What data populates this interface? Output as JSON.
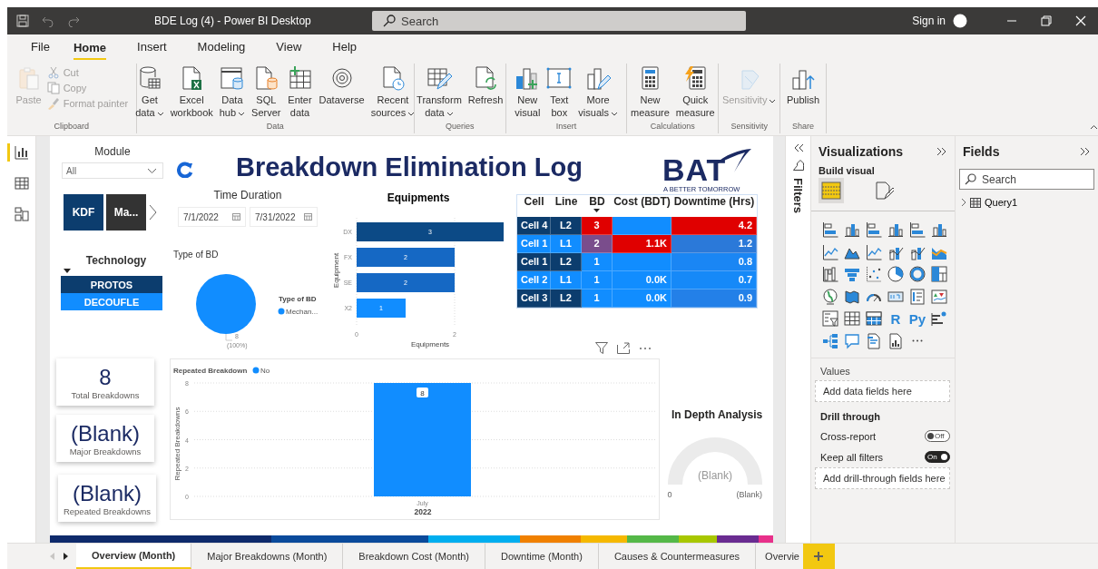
{
  "title_bar": {
    "title": "BDE Log (4) - Power BI Desktop",
    "search": {
      "placeholder": "Search"
    },
    "sign_in": "Sign in"
  },
  "menu_tabs": [
    {
      "label": "File",
      "selected": false
    },
    {
      "label": "Home",
      "selected": true
    },
    {
      "label": "Insert",
      "selected": false
    },
    {
      "label": "Modeling",
      "selected": false
    },
    {
      "label": "View",
      "selected": false
    },
    {
      "label": "Help",
      "selected": false
    }
  ],
  "ribbon": {
    "groups": [
      {
        "label": "Clipboard",
        "buttons": [
          {
            "kind": "large",
            "lines": [
              "Paste"
            ],
            "dropdown": false,
            "disabled": true
          },
          {
            "kind": "small",
            "lines": [
              "Cut"
            ],
            "dropdown": false,
            "disabled": true
          },
          {
            "kind": "small",
            "lines": [
              "Copy"
            ],
            "dropdown": false,
            "disabled": true
          },
          {
            "kind": "small",
            "lines": [
              "Format painter"
            ],
            "dropdown": false,
            "disabled": true
          }
        ]
      },
      {
        "label": "Data",
        "buttons": [
          {
            "kind": "large",
            "lines": [
              "Get",
              "data"
            ],
            "dropdown": true,
            "disabled": false
          },
          {
            "kind": "large",
            "lines": [
              "Excel",
              "workbook"
            ],
            "dropdown": false,
            "disabled": false
          },
          {
            "kind": "large",
            "lines": [
              "Data",
              "hub"
            ],
            "dropdown": true,
            "disabled": false
          },
          {
            "kind": "large",
            "lines": [
              "SQL",
              "Server"
            ],
            "dropdown": false,
            "disabled": false
          },
          {
            "kind": "large",
            "lines": [
              "Enter",
              "data"
            ],
            "dropdown": false,
            "disabled": false
          },
          {
            "kind": "large",
            "lines": [
              "Dataverse"
            ],
            "dropdown": false,
            "disabled": false
          },
          {
            "kind": "large",
            "lines": [
              "Recent",
              "sources"
            ],
            "dropdown": true,
            "disabled": false
          }
        ]
      },
      {
        "label": "Queries",
        "buttons": [
          {
            "kind": "large",
            "lines": [
              "Transform",
              "data"
            ],
            "dropdown": true,
            "disabled": false
          },
          {
            "kind": "large",
            "lines": [
              "Refresh"
            ],
            "dropdown": false,
            "disabled": false
          }
        ]
      },
      {
        "label": "Insert",
        "buttons": [
          {
            "kind": "large",
            "lines": [
              "New",
              "visual"
            ],
            "dropdown": false,
            "disabled": false
          },
          {
            "kind": "large",
            "lines": [
              "Text",
              "box"
            ],
            "dropdown": false,
            "disabled": false
          },
          {
            "kind": "large",
            "lines": [
              "More",
              "visuals"
            ],
            "dropdown": true,
            "disabled": false
          }
        ]
      },
      {
        "label": "Calculations",
        "buttons": [
          {
            "kind": "large",
            "lines": [
              "New",
              "measure"
            ],
            "dropdown": false,
            "disabled": false
          },
          {
            "kind": "large",
            "lines": [
              "Quick",
              "measure"
            ],
            "dropdown": false,
            "disabled": false
          }
        ]
      },
      {
        "label": "Sensitivity",
        "buttons": [
          {
            "kind": "large",
            "lines": [
              "Sensitivity"
            ],
            "dropdown": true,
            "disabled": true
          }
        ]
      },
      {
        "label": "Share",
        "buttons": [
          {
            "kind": "large",
            "lines": [
              "Publish"
            ],
            "dropdown": false,
            "disabled": false
          }
        ]
      }
    ]
  },
  "left_rail": {
    "views": [
      {
        "selected": true
      },
      {
        "selected": false
      },
      {
        "selected": false
      }
    ]
  },
  "report": {
    "module_slicer": {
      "label": "Module",
      "value": "All"
    },
    "title": "Breakdown Elimination Log",
    "logo": {
      "name": "BAT",
      "tagline": "A BETTER TOMORROW"
    },
    "tile_slicer": {
      "items": [
        {
          "label": "KDF",
          "selected": true
        },
        {
          "label": "Ma...",
          "selected": false
        }
      ]
    },
    "time_duration": {
      "label": "Time Duration",
      "start": "7/1/2022",
      "end": "7/31/2022"
    },
    "technology_slicer": {
      "label": "Technology",
      "items": [
        {
          "label": "PROTOS",
          "selected": true
        },
        {
          "label": "DECOUFLE",
          "selected": false
        }
      ]
    },
    "type_of_bd": {
      "chart_data": {
        "type": "pie",
        "title": "Type of BD",
        "categories": [
          "Mechan..."
        ],
        "series": [
          {
            "name": "Type of BD",
            "color": "#118dff",
            "values": [
              8
            ]
          }
        ],
        "data_labels": true
      },
      "percent_labels": [
        "(100%)"
      ]
    },
    "equipments": {
      "chart_data": {
        "type": "bar",
        "orientation": "horizontal",
        "title": "Equipments",
        "xlabel": "Equipments",
        "ylabel": "Equipment",
        "categories": [
          "DX",
          "FX",
          "SE",
          "X2"
        ],
        "series": [
          {
            "values": [
              3,
              2,
              2,
              1
            ]
          }
        ],
        "xlim": [
          0,
          3
        ],
        "xticks": [
          0,
          2
        ],
        "grid": true,
        "data_labels": true
      },
      "bars": [
        {
          "color": "#0c4a86"
        },
        {
          "color": "#1568c4"
        },
        {
          "color": "#1568c4"
        },
        {
          "color": "#118dff"
        }
      ]
    },
    "matrix": {
      "columns": [
        {
          "label": "Cell",
          "sorted": false
        },
        {
          "label": "Line",
          "sorted": false
        },
        {
          "label": "BD",
          "sorted": true
        },
        {
          "label": "Cost (BDT)",
          "sorted": false
        },
        {
          "label": "Downtime (Hrs)",
          "sorted": false
        }
      ],
      "rows": [
        {
          "cells": [
            {
              "text": "Cell 4",
              "color": "#0c3d6e"
            },
            {
              "text": "L2",
              "color": "#0c3d6e"
            },
            {
              "text": "3",
              "color": "#e00000"
            },
            {
              "text": "",
              "color": "#118dff"
            },
            {
              "text": "4.2",
              "color": "#e00000"
            }
          ]
        },
        {
          "cells": [
            {
              "text": "Cell 1",
              "color": "#118dff"
            },
            {
              "text": "L1",
              "color": "#118dff"
            },
            {
              "text": "2",
              "color": "#7a4d8c"
            },
            {
              "text": "1.1K",
              "color": "#e00000"
            },
            {
              "text": "1.2",
              "color": "#2b79d9"
            }
          ]
        },
        {
          "cells": [
            {
              "text": "Cell 1",
              "color": "#0c3d6e"
            },
            {
              "text": "L2",
              "color": "#0c3d6e"
            },
            {
              "text": "1",
              "color": "#118dff"
            },
            {
              "text": "",
              "color": "#118dff"
            },
            {
              "text": "0.8",
              "color": "#1a86f4"
            }
          ]
        },
        {
          "cells": [
            {
              "text": "Cell 2",
              "color": "#118dff"
            },
            {
              "text": "L1",
              "color": "#118dff"
            },
            {
              "text": "1",
              "color": "#118dff"
            },
            {
              "text": "0.0K",
              "color": "#118dff"
            },
            {
              "text": "0.7",
              "color": "#1689f8"
            }
          ]
        },
        {
          "cells": [
            {
              "text": "Cell 3",
              "color": "#0c3d6e"
            },
            {
              "text": "L2",
              "color": "#0c3d6e"
            },
            {
              "text": "1",
              "color": "#118dff"
            },
            {
              "text": "0.0K",
              "color": "#118dff"
            },
            {
              "text": "0.9",
              "color": "#2380e8"
            }
          ]
        }
      ]
    },
    "cards": [
      {
        "value": "8",
        "label": "Total Breakdowns"
      },
      {
        "value": "(Blank)",
        "label": "Major Breakdowns"
      },
      {
        "value": "(Blank)",
        "label": "Repeated Breakdowns"
      }
    ],
    "repeated_breakdown": {
      "chart_data": {
        "type": "bar",
        "title": "Repeated Breakdown",
        "ylabel": "Repeated Breakdowns",
        "categories": [
          "July"
        ],
        "series": [
          {
            "name": "No",
            "color": "#118dff",
            "values": [
              8
            ]
          }
        ],
        "ylim": [
          0,
          8
        ],
        "yticks": [
          0,
          2,
          4,
          6,
          8
        ],
        "grid": true,
        "data_labels": true
      },
      "category_group": "2022"
    },
    "in_depth": {
      "title": "In Depth Analysis",
      "value": "(Blank)",
      "min": "0",
      "max": "(Blank)"
    }
  },
  "filters_pane": {
    "label": "Filters"
  },
  "visualizations": {
    "title": "Visualizations",
    "subtitle": "Build visual",
    "modes": [
      {
        "selected": true
      },
      {
        "selected": false
      }
    ],
    "glyph_icons": [
      "R",
      "Py"
    ],
    "values_label": "Values",
    "values_well": "Add data fields here",
    "drill_title": "Drill through",
    "toggles": [
      {
        "label": "Cross-report",
        "state": "Off",
        "on": false
      },
      {
        "label": "Keep all filters",
        "state": "On",
        "on": true
      }
    ],
    "drill_well": "Add drill-through fields here"
  },
  "fields": {
    "title": "Fields",
    "search": {
      "placeholder": "Search"
    },
    "tables": [
      {
        "name": "Query1",
        "expanded": false
      }
    ]
  },
  "page_tabs": [
    {
      "label": "Overview (Month)",
      "selected": true
    },
    {
      "label": "Major Breakdowns (Month)",
      "selected": false
    },
    {
      "label": "Breakdown Cost (Month)",
      "selected": false
    },
    {
      "label": "Downtime (Month)",
      "selected": false
    },
    {
      "label": "Causes & Countermeasures",
      "selected": false
    },
    {
      "label": "Overvie",
      "selected": false
    }
  ]
}
